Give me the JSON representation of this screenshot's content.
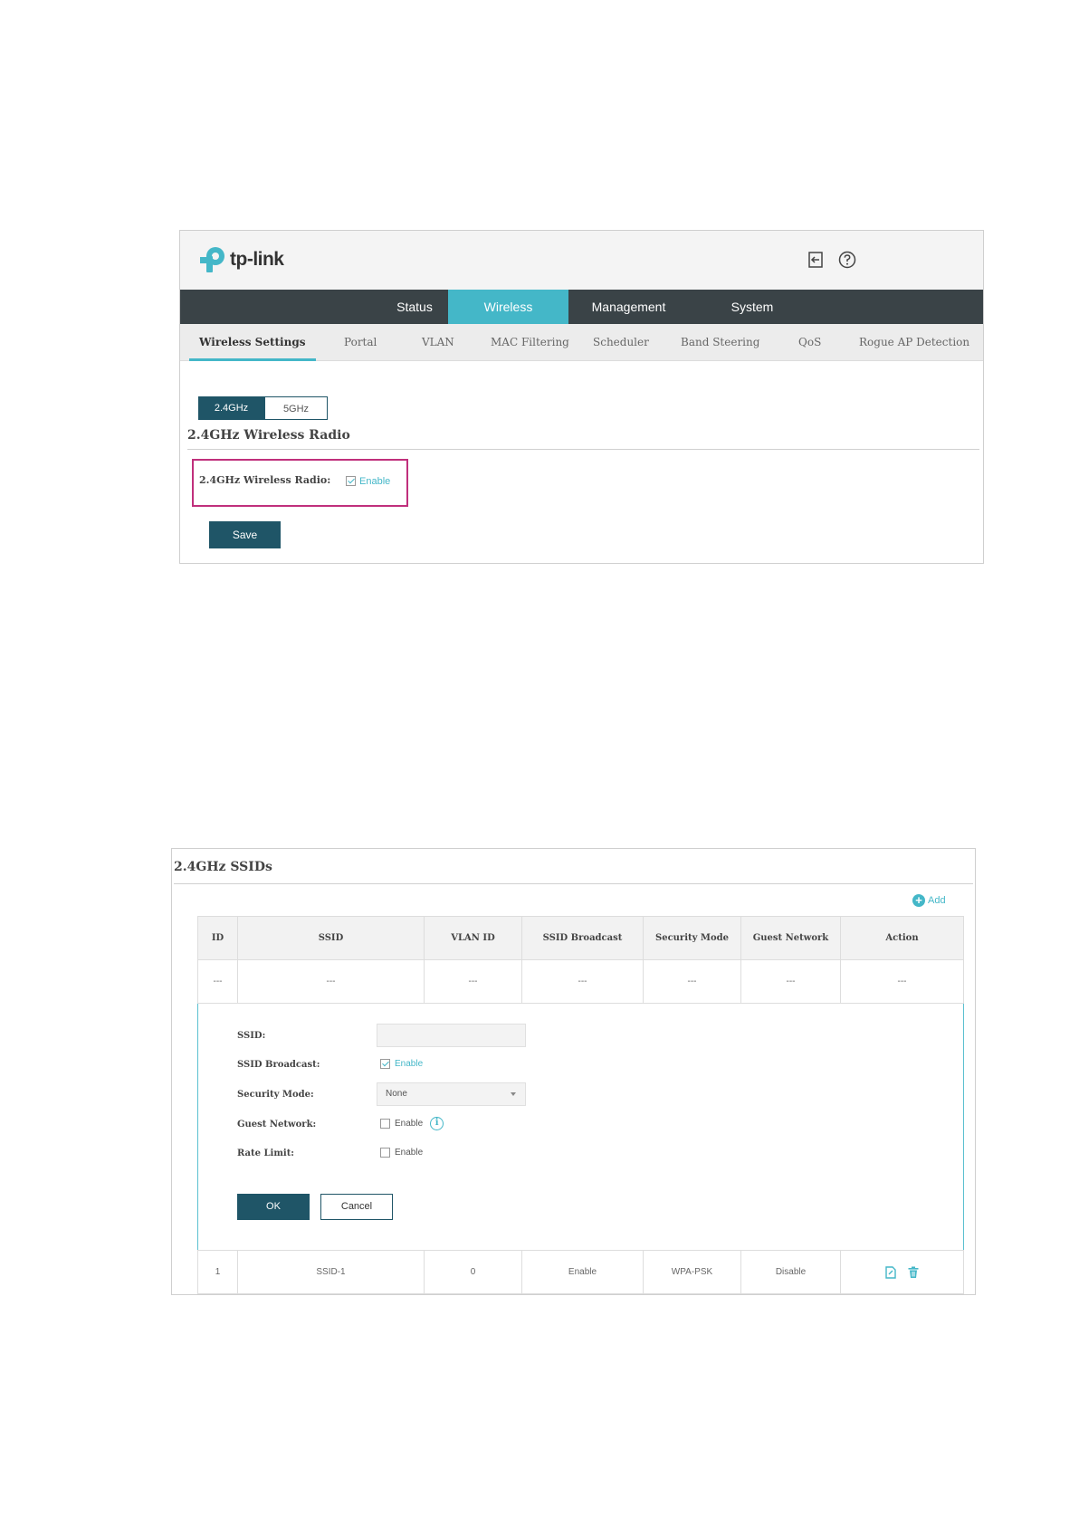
{
  "top_screenshot": {
    "logo_text": "tp-link",
    "header_icons": [
      "logout-icon",
      "help-icon"
    ],
    "nav_tabs": [
      {
        "label": "Status",
        "active": false
      },
      {
        "label": "Wireless",
        "active": true
      },
      {
        "label": "Management",
        "active": false
      },
      {
        "label": "System",
        "active": false
      }
    ],
    "sub_tabs": [
      {
        "label": "Wireless Settings",
        "active": true
      },
      {
        "label": "Portal",
        "active": false
      },
      {
        "label": "VLAN",
        "active": false
      },
      {
        "label": "MAC Filtering",
        "active": false
      },
      {
        "label": "Scheduler",
        "active": false
      },
      {
        "label": "Band Steering",
        "active": false
      },
      {
        "label": "QoS",
        "active": false
      },
      {
        "label": "Rogue AP Detection",
        "active": false
      }
    ],
    "band_buttons": [
      {
        "label": "2.4GHz",
        "active": true
      },
      {
        "label": "5GHz",
        "active": false
      }
    ],
    "section_title": "2.4GHz Wireless Radio",
    "radio": {
      "label": "2.4GHz Wireless Radio:",
      "option": "Enable",
      "checked": true
    },
    "save_label": "Save",
    "colors": {
      "nav_bg": "#3a4347",
      "accent": "#44b7c8",
      "button": "#1f5567",
      "highlight_box": "#c0307c"
    }
  },
  "bottom_screenshot": {
    "title": "2.4GHz SSIDs",
    "add_label": "Add",
    "table": {
      "columns": [
        "ID",
        "SSID",
        "VLAN ID",
        "SSID Broadcast",
        "Security Mode",
        "Guest Network",
        "Action"
      ],
      "empty_row": [
        "---",
        "---",
        "---",
        "---",
        "---",
        "---",
        "---"
      ],
      "rows": [
        {
          "id": "1",
          "ssid": "SSID-1",
          "vlan_id": "0",
          "broadcast": "Enable",
          "security": "WPA-PSK",
          "guest": "Disable",
          "actions": [
            "edit-icon",
            "delete-icon"
          ]
        }
      ]
    },
    "form": {
      "ssid_label": "SSID:",
      "ssid_value": "",
      "broadcast_label": "SSID Broadcast:",
      "broadcast_option": "Enable",
      "broadcast_checked": true,
      "security_label": "Security Mode:",
      "security_value": "None",
      "guest_label": "Guest Network:",
      "guest_option": "Enable",
      "guest_checked": false,
      "rate_label": "Rate Limit:",
      "rate_option": "Enable",
      "rate_checked": false,
      "ok_label": "OK",
      "cancel_label": "Cancel"
    }
  }
}
